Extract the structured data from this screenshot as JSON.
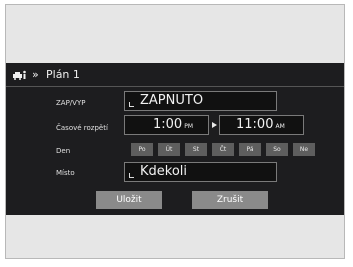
{
  "header": {
    "title": "Plán 1"
  },
  "labels": {
    "status": "ZAP/VYP",
    "time_range": "Časové rozpětí",
    "day": "Den",
    "place": "Místo"
  },
  "fields": {
    "status_value": "ZAPNUTO",
    "start_time": "1:00",
    "start_ampm": "PM",
    "end_time": "11:00",
    "end_ampm": "AM",
    "place_value": "Kdekoli"
  },
  "days": [
    "Po",
    "Út",
    "St",
    "Čt",
    "Pá",
    "So",
    "Ne"
  ],
  "buttons": {
    "save": "Uložit",
    "cancel": "Zrušit"
  },
  "icons": {
    "vehicle": "car-person-icon",
    "nav": "double-chevron-right-icon",
    "arrow": "triangle-right-icon"
  }
}
